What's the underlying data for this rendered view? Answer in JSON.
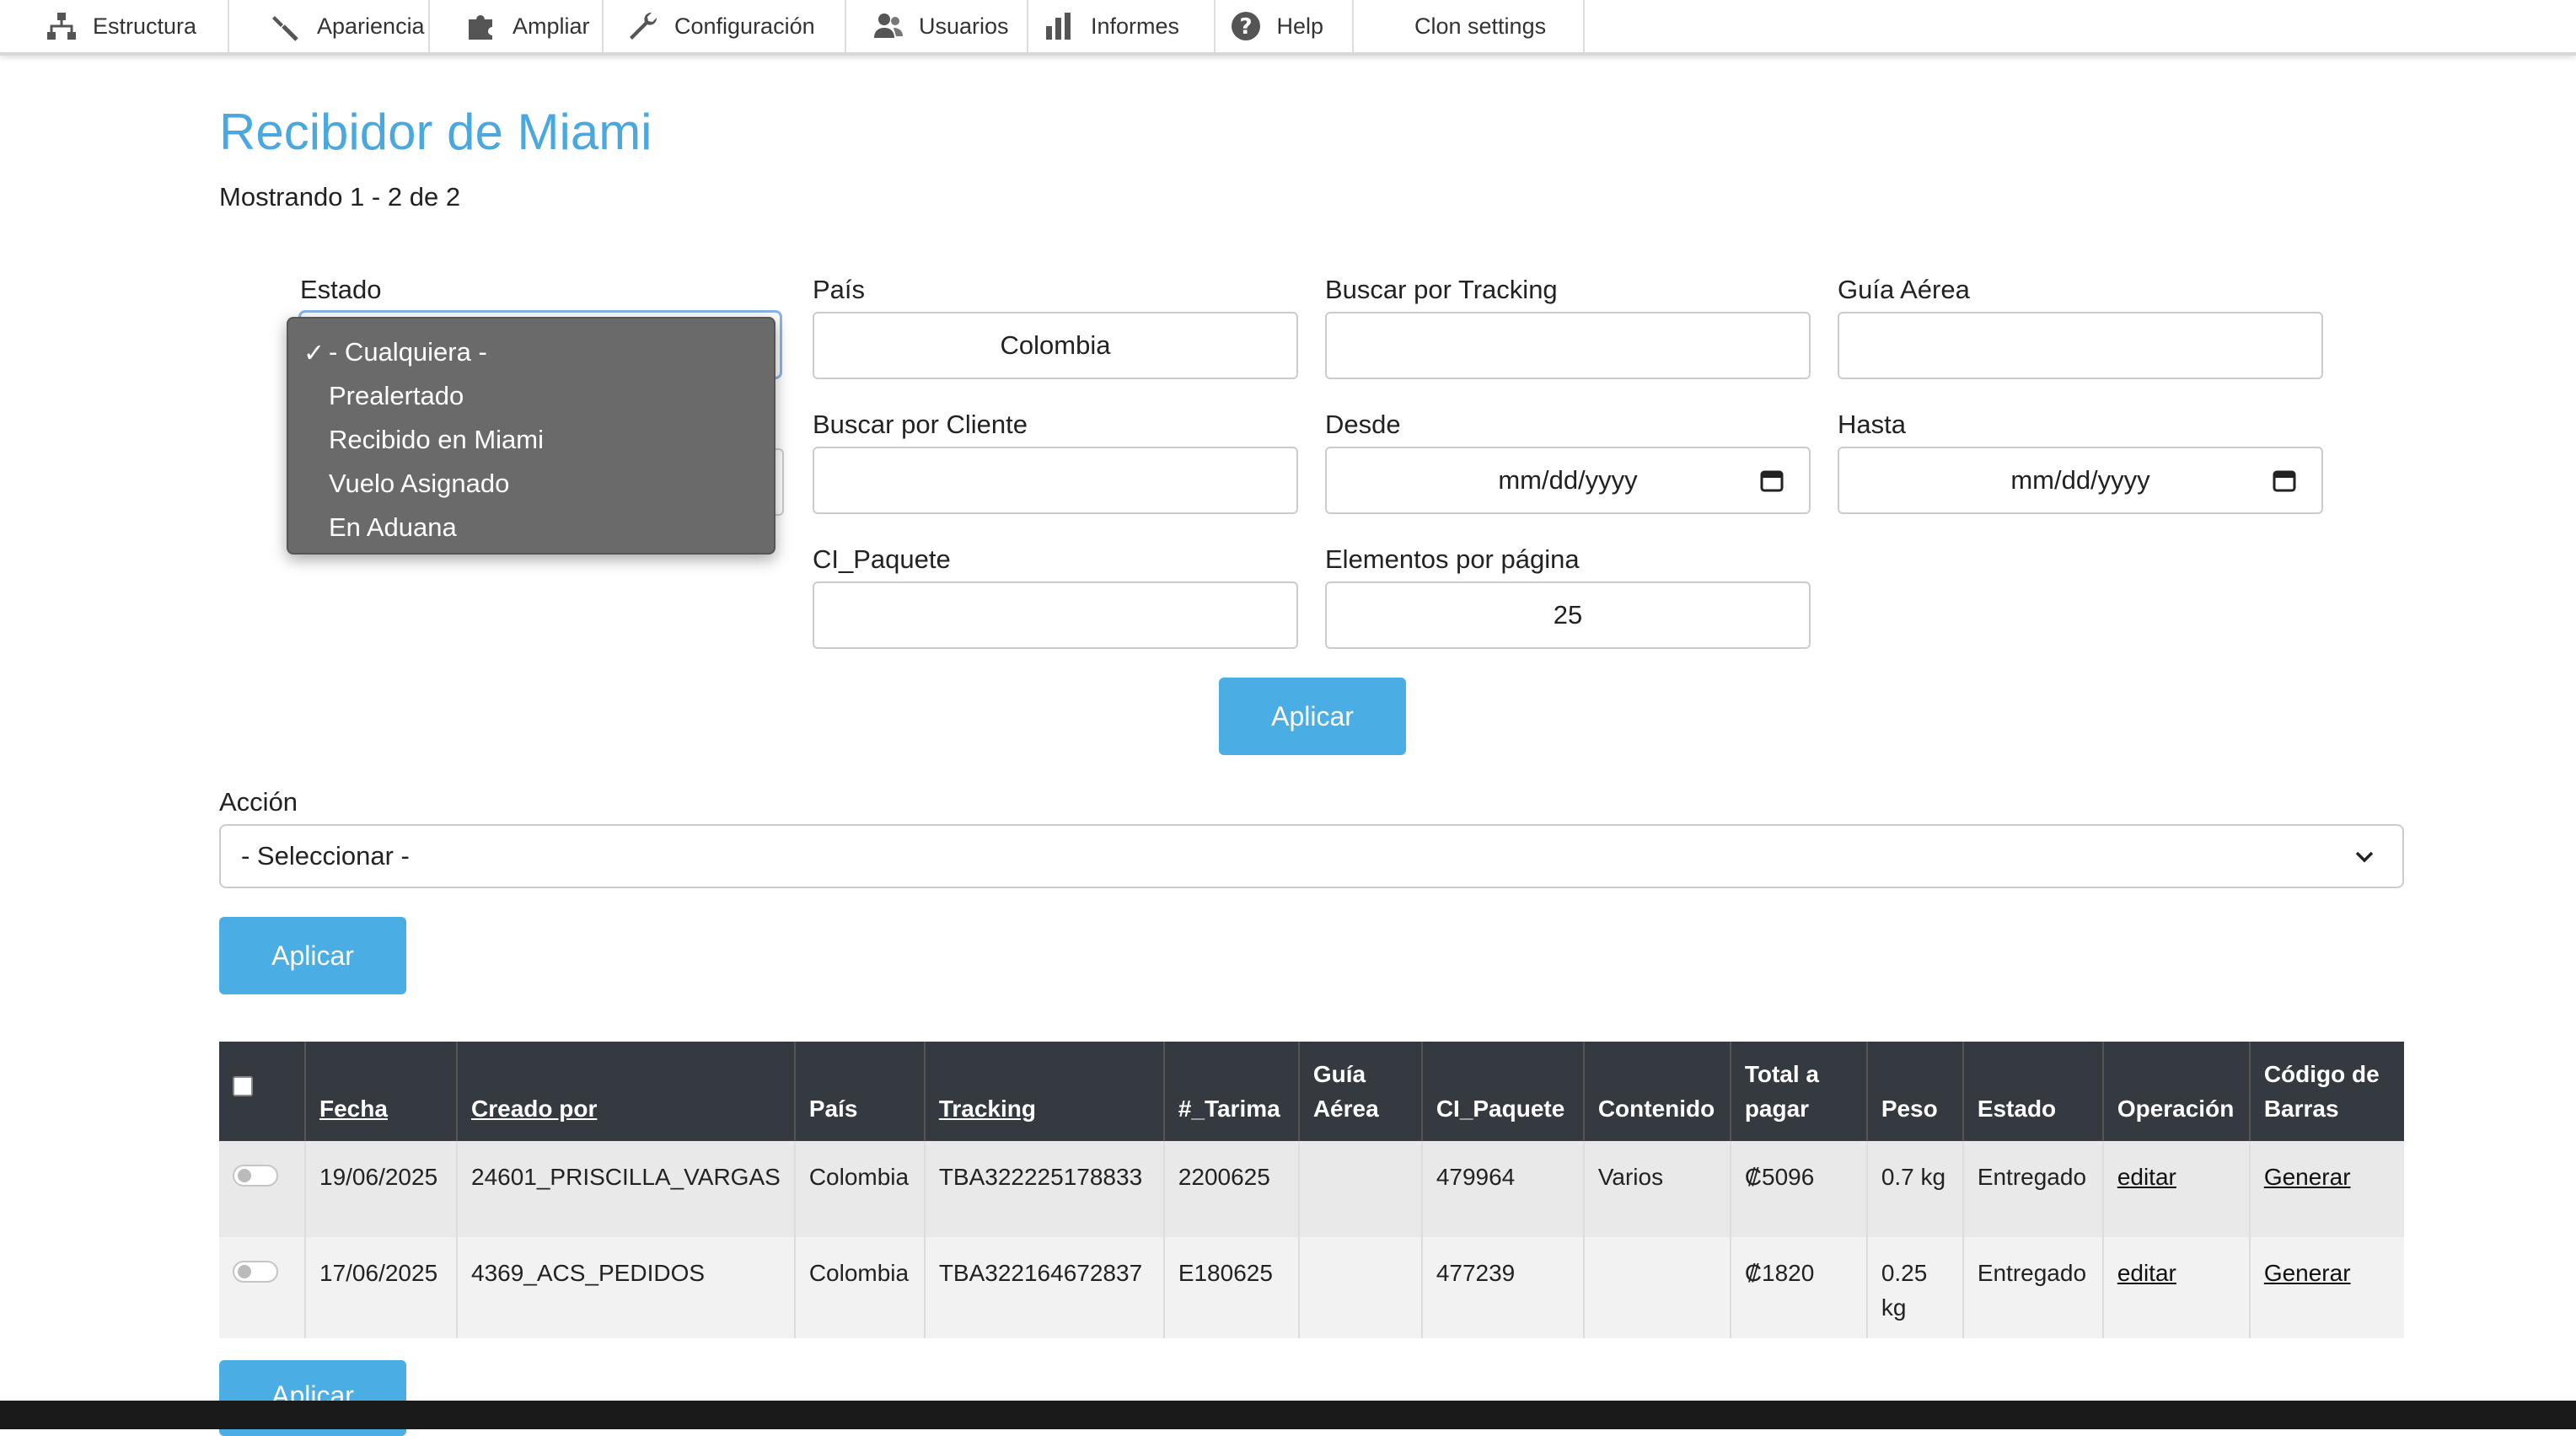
{
  "toolbar": {
    "items": [
      {
        "label": "Estructura",
        "icon": "sitemap-icon"
      },
      {
        "label": "Apariencia",
        "icon": "wrench-brush-icon"
      },
      {
        "label": "Ampliar",
        "icon": "puzzle-icon"
      },
      {
        "label": "Configuración",
        "icon": "wrench-icon"
      },
      {
        "label": "Usuarios",
        "icon": "users-icon"
      },
      {
        "label": "Informes",
        "icon": "bar-chart-icon"
      },
      {
        "label": "Help",
        "icon": "help-icon"
      },
      {
        "label": "Clon settings",
        "icon": ""
      }
    ]
  },
  "page": {
    "title": "Recibidor de Miami",
    "showing": "Mostrando 1 - 2 de 2"
  },
  "filters": {
    "estado_label": "Estado",
    "estado_options": [
      "- Cualquiera -",
      "Prealertado",
      "Recibido en Miami",
      "Vuelo Asignado",
      "En Aduana"
    ],
    "estado_selected": "- Cualquiera -",
    "pais_label": "País",
    "pais_value": "Colombia",
    "tracking_label": "Buscar por Tracking",
    "tracking_value": "",
    "guia_label": "Guía Aérea",
    "guia_value": "",
    "cliente_label": "Buscar por Cliente",
    "cliente_value": "",
    "desde_label": "Desde",
    "desde_placeholder": "mm/dd/yyyy",
    "hasta_label": "Hasta",
    "hasta_placeholder": "mm/dd/yyyy",
    "ci_label": "CI_Paquete",
    "ci_value": "",
    "elementos_label": "Elementos por página",
    "elementos_value": "25",
    "apply_label": "Aplicar"
  },
  "accion": {
    "label": "Acción",
    "selected": "- Seleccionar -",
    "apply_label": "Aplicar"
  },
  "table": {
    "headers": [
      "Fecha",
      "Creado por",
      "País",
      "Tracking",
      "#_Tarima",
      "Guía Aérea",
      "CI_Paquete",
      "Contenido",
      "Total a pagar",
      "Peso",
      "Estado",
      "Operación",
      "Código de Barras"
    ],
    "rows": [
      {
        "fecha": "19/06/2025",
        "creado": "24601_PRISCILLA_VARGAS",
        "pais": "Colombia",
        "tracking": "TBA322225178833",
        "tarima": "2200625",
        "guia": "",
        "ci": "479964",
        "contenido": "Varios",
        "total": "₡5096",
        "peso": "0.7 kg",
        "estado": "Entregado",
        "operacion": "editar",
        "codigo": "Generar"
      },
      {
        "fecha": "17/06/2025",
        "creado": "4369_ACS_PEDIDOS",
        "pais": "Colombia",
        "tracking": "TBA322164672837",
        "tarima": "E180625",
        "guia": "",
        "ci": "477239",
        "contenido": "",
        "total": "₡1820",
        "peso": "0.25 kg",
        "estado": "Entregado",
        "operacion": "editar",
        "codigo": "Generar"
      }
    ]
  },
  "bottom": {
    "apply_label": "Aplicar"
  }
}
